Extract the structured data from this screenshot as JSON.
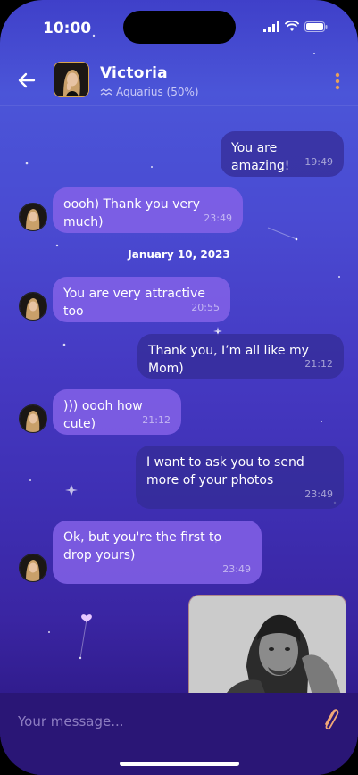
{
  "status": {
    "time": "10:00"
  },
  "header": {
    "name": "Victoria",
    "subtitle": "Aquarius (50%)",
    "back_icon": "arrow-left-icon",
    "menu_icon": "more-vertical-icon",
    "zodiac_icon": "aquarius-icon",
    "menu_color": "#e8a15a"
  },
  "messages": [
    {
      "direction": "out",
      "text": "You are amazing!",
      "time": "19:49"
    },
    {
      "direction": "in",
      "text": "oooh) Thank you very much)",
      "time": "23:49"
    },
    {
      "direction": "date",
      "text": "January 10, 2023"
    },
    {
      "direction": "in",
      "text": "You are very attractive too",
      "time": "20:55"
    },
    {
      "direction": "out",
      "text": "Thank you, I’m all like my Mom)",
      "time": "21:12"
    },
    {
      "direction": "in",
      "text": "))) oooh how cute)",
      "time": "21:12"
    },
    {
      "direction": "out",
      "text": "I want to ask you to send more of your photos",
      "time": "23:49"
    },
    {
      "direction": "in",
      "text": "Ok, but you're the first to drop yours)",
      "time": "23:49"
    },
    {
      "direction": "out",
      "type": "photo"
    }
  ],
  "composer": {
    "placeholder": "Your message...",
    "attach_icon": "paperclip-icon",
    "accent": "#f0a877"
  }
}
